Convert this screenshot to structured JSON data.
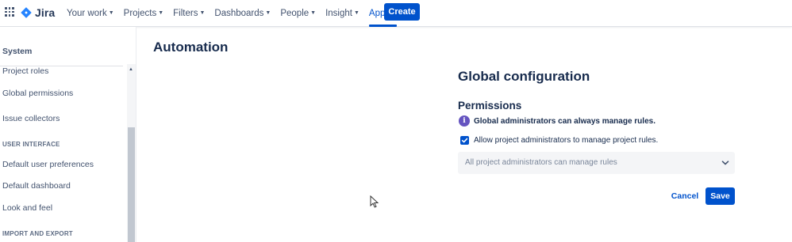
{
  "topnav": {
    "logo_text": "Jira",
    "items": [
      {
        "label": "Your work",
        "active": false
      },
      {
        "label": "Projects",
        "active": false
      },
      {
        "label": "Filters",
        "active": false
      },
      {
        "label": "Dashboards",
        "active": false
      },
      {
        "label": "People",
        "active": false
      },
      {
        "label": "Insight",
        "active": false
      },
      {
        "label": "Apps",
        "active": true
      }
    ],
    "create_label": "Create",
    "accent_color": "#0052cc"
  },
  "sidebar": {
    "title": "System",
    "items": [
      {
        "label": "Project roles"
      },
      {
        "label": "Global permissions"
      },
      {
        "label": "Issue collectors"
      }
    ],
    "section_ui": "USER INTERFACE",
    "ui_items": [
      {
        "label": "Default user preferences"
      },
      {
        "label": "Default dashboard"
      },
      {
        "label": "Look and feel"
      }
    ],
    "section_import": "IMPORT AND EXPORT"
  },
  "main": {
    "page_title": "Automation",
    "config_title": "Global configuration",
    "permissions_title": "Permissions",
    "info_icon_glyph": "i",
    "info_text": "Global administrators can always manage rules.",
    "checkbox_label": "Allow project administrators to manage project rules.",
    "checkbox_checked": true,
    "select_value": "All project administrators can manage rules",
    "cancel_label": "Cancel",
    "save_label": "Save",
    "info_color": "#6554c0"
  }
}
